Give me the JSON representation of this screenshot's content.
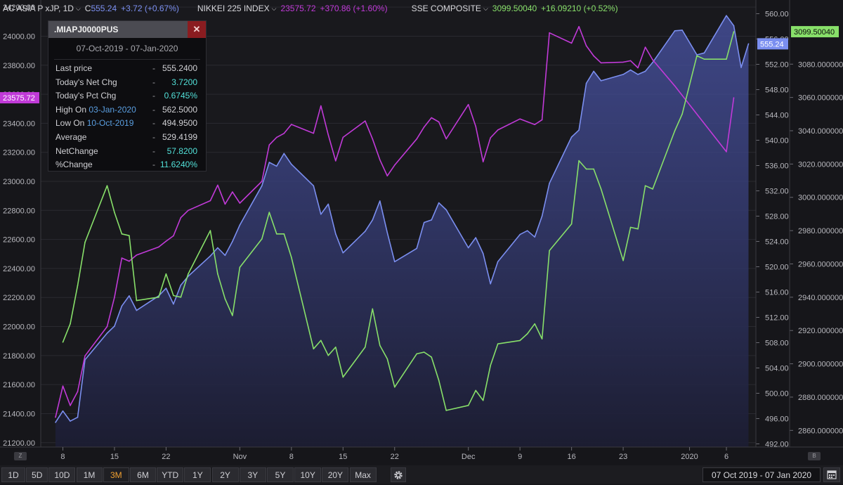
{
  "legend": {
    "s1_name": "AC ASIA P xJP, 1D",
    "s1_prefix": "C",
    "s1_last": "555.24",
    "s1_change": "+3.72 (+0.67%)",
    "s2_name": "NIKKEI 225 INDEX",
    "s2_last": "23575.72",
    "s2_change": "+370.86 (+1.60%)",
    "s3_name": "SSE COMPOSITE",
    "s3_last": "3099.50040",
    "s3_change": "+16.09210 (+0.52%)",
    "chevron": "chevron-down-icon"
  },
  "infobox": {
    "title": ".MIAPJ0000PUS",
    "close": "✕",
    "dates": "07-Oct-2019 - 07-Jan-2020",
    "rows": [
      {
        "label": "Last price",
        "dash": "-",
        "value": "555.2400"
      },
      {
        "label": "Today's Net Chg",
        "dash": "-",
        "value": "3.7200"
      },
      {
        "label": "Today's Pct Chg",
        "dash": "-",
        "value": "0.6745%"
      },
      {
        "label": "High On ",
        "date": "03-Jan-2020",
        "dash": "-",
        "value": "562.5000"
      },
      {
        "label": "Low On ",
        "date": "10-Oct-2019",
        "dash": "-",
        "value": "494.9500"
      },
      {
        "label": "Average",
        "dash": "-",
        "value": "529.4199"
      },
      {
        "label": "NetChange",
        "dash": "-",
        "value": "57.8200"
      },
      {
        "label": "%Change",
        "dash": "-",
        "value": "11.6240%"
      }
    ]
  },
  "toolbar": {
    "ranges": [
      "1D",
      "5D",
      "10D",
      "1M",
      "3M",
      "6M",
      "YTD",
      "1Y",
      "2Y",
      "3Y",
      "5Y",
      "10Y",
      "20Y",
      "Max"
    ],
    "active": "3M",
    "date_range": "07 Oct 2019  -  07 Jan 2020",
    "settings_icon": "gear-icon",
    "calendar_icon": "calendar-icon",
    "zoom_left": "Z",
    "zoom_right": "B"
  },
  "colors": {
    "s1": "#7b8ff0",
    "s2": "#c13ad8",
    "s3": "#88e06a",
    "background": "#16161a"
  },
  "chart_data": {
    "type": "line",
    "x_ticks": [
      "8",
      "15",
      "22",
      "Nov",
      "8",
      "15",
      "22",
      "Dec",
      "9",
      "16",
      "23",
      "2020",
      "6"
    ],
    "x_tick_dates": [
      "2019-10-08",
      "2019-10-15",
      "2019-10-22",
      "2019-11-01",
      "2019-11-08",
      "2019-11-15",
      "2019-11-22",
      "2019-12-02",
      "2019-12-09",
      "2019-12-16",
      "2019-12-23",
      "2020-01-01",
      "2020-01-06"
    ],
    "y_left": {
      "label": "NIKKEI 225 INDEX",
      "ticks": [
        "24200.00",
        "24000.00",
        "23800.00",
        "23600.00",
        "23400.00",
        "23200.00",
        "23000.00",
        "22800.00",
        "22600.00",
        "22400.00",
        "22200.00",
        "22000.00",
        "21800.00",
        "21600.00",
        "21400.00",
        "21200.00"
      ],
      "range": [
        21170,
        24220
      ]
    },
    "y_right1": {
      "label": "AC ASIA P xJP",
      "ticks": [
        "560.00",
        "556.00",
        "552.00",
        "548.00",
        "544.00",
        "540.00",
        "536.00",
        "532.00",
        "528.00",
        "524.00",
        "520.00",
        "516.00",
        "512.00",
        "508.00",
        "504.00",
        "500.00",
        "496.00",
        "492.00"
      ],
      "range": [
        491.5,
        561.5
      ]
    },
    "y_right2": {
      "label": "SSE COMPOSITE",
      "ticks": [
        "3080.000000",
        "3060.000000",
        "3040.000000",
        "3020.000000",
        "3000.000000",
        "2980.000000",
        "2960.000000",
        "2940.000000",
        "2920.000000",
        "2900.000000",
        "2880.000000",
        "2860.000000"
      ],
      "range": [
        2850,
        3116
      ]
    },
    "last_labels": {
      "s1": "555.24",
      "s2": "23575.72",
      "s3": "3099.50040"
    },
    "series": [
      {
        "name": "AC ASIA P xJP",
        "color": "#7b8ff0",
        "area": true,
        "points": [
          [
            "2019-10-07",
            495.4
          ],
          [
            "2019-10-08",
            497.2
          ],
          [
            "2019-10-09",
            495.6
          ],
          [
            "2019-10-10",
            496.2
          ],
          [
            "2019-10-11",
            505.3
          ],
          [
            "2019-10-14",
            509.5
          ],
          [
            "2019-10-15",
            510.6
          ],
          [
            "2019-10-16",
            513.8
          ],
          [
            "2019-10-17",
            515.4
          ],
          [
            "2019-10-18",
            513.1
          ],
          [
            "2019-10-21",
            515.4
          ],
          [
            "2019-10-22",
            516.6
          ],
          [
            "2019-10-23",
            514.1
          ],
          [
            "2019-10-24",
            517.1
          ],
          [
            "2019-10-25",
            518.5
          ],
          [
            "2019-10-28",
            521.7
          ],
          [
            "2019-10-29",
            523.0
          ],
          [
            "2019-10-30",
            521.8
          ],
          [
            "2019-10-31",
            524.0
          ],
          [
            "2019-11-01",
            526.6
          ],
          [
            "2019-11-04",
            532.8
          ],
          [
            "2019-11-05",
            536.5
          ],
          [
            "2019-11-06",
            535.9
          ],
          [
            "2019-11-07",
            537.9
          ],
          [
            "2019-11-08",
            536.2
          ],
          [
            "2019-11-11",
            532.8
          ],
          [
            "2019-11-12",
            528.3
          ],
          [
            "2019-11-13",
            529.9
          ],
          [
            "2019-11-14",
            525.2
          ],
          [
            "2019-11-15",
            522.2
          ],
          [
            "2019-11-18",
            525.6
          ],
          [
            "2019-11-19",
            527.4
          ],
          [
            "2019-11-20",
            530.4
          ],
          [
            "2019-11-21",
            525.4
          ],
          [
            "2019-11-22",
            520.8
          ],
          [
            "2019-11-25",
            522.9
          ],
          [
            "2019-11-26",
            527.0
          ],
          [
            "2019-11-27",
            527.4
          ],
          [
            "2019-11-28",
            530.1
          ],
          [
            "2019-11-29",
            529.0
          ],
          [
            "2019-12-02",
            523.0
          ],
          [
            "2019-12-03",
            524.6
          ],
          [
            "2019-12-04",
            522.1
          ],
          [
            "2019-12-05",
            517.3
          ],
          [
            "2019-12-06",
            520.8
          ],
          [
            "2019-12-09",
            525.1
          ],
          [
            "2019-12-10",
            525.7
          ],
          [
            "2019-12-11",
            524.7
          ],
          [
            "2019-12-12",
            528.0
          ],
          [
            "2019-12-13",
            533.2
          ],
          [
            "2019-12-16",
            540.5
          ],
          [
            "2019-12-17",
            541.6
          ],
          [
            "2019-12-18",
            549.0
          ],
          [
            "2019-12-19",
            550.9
          ],
          [
            "2019-12-20",
            549.4
          ],
          [
            "2019-12-23",
            550.4
          ],
          [
            "2019-12-24",
            551.1
          ],
          [
            "2019-12-25",
            550.4
          ],
          [
            "2019-12-26",
            550.9
          ],
          [
            "2019-12-27",
            552.3
          ],
          [
            "2019-12-30",
            557.3
          ],
          [
            "2019-12-31",
            557.4
          ],
          [
            "2020-01-02",
            553.5
          ],
          [
            "2020-01-03",
            553.8
          ],
          [
            "2020-01-06",
            559.7
          ],
          [
            "2020-01-07",
            558.1
          ],
          [
            "2020-01-08",
            551.5
          ],
          [
            "2020-01-09",
            555.24
          ]
        ]
      },
      {
        "name": "NIKKEI 225 INDEX",
        "color": "#c13ad8",
        "area": false,
        "points": [
          [
            "2019-10-07",
            21375
          ],
          [
            "2019-10-08",
            21590
          ],
          [
            "2019-10-09",
            21456
          ],
          [
            "2019-10-10",
            21552
          ],
          [
            "2019-10-11",
            21798
          ],
          [
            "2019-10-14",
            22000
          ],
          [
            "2019-10-15",
            22200
          ],
          [
            "2019-10-16",
            22472
          ],
          [
            "2019-10-17",
            22450
          ],
          [
            "2019-10-18",
            22492
          ],
          [
            "2019-10-21",
            22548
          ],
          [
            "2019-10-22",
            22588
          ],
          [
            "2019-10-23",
            22625
          ],
          [
            "2019-10-24",
            22750
          ],
          [
            "2019-10-25",
            22800
          ],
          [
            "2019-10-28",
            22867
          ],
          [
            "2019-10-29",
            22974
          ],
          [
            "2019-10-30",
            22843
          ],
          [
            "2019-10-31",
            22927
          ],
          [
            "2019-11-01",
            22850
          ],
          [
            "2019-11-04",
            23000
          ],
          [
            "2019-11-05",
            23251
          ],
          [
            "2019-11-06",
            23303
          ],
          [
            "2019-11-07",
            23330
          ],
          [
            "2019-11-08",
            23392
          ],
          [
            "2019-11-11",
            23331
          ],
          [
            "2019-11-12",
            23520
          ],
          [
            "2019-11-13",
            23320
          ],
          [
            "2019-11-14",
            23141
          ],
          [
            "2019-11-15",
            23303
          ],
          [
            "2019-11-18",
            23416
          ],
          [
            "2019-11-19",
            23292
          ],
          [
            "2019-11-20",
            23148
          ],
          [
            "2019-11-21",
            23038
          ],
          [
            "2019-11-22",
            23112
          ],
          [
            "2019-11-25",
            23292
          ],
          [
            "2019-11-26",
            23374
          ],
          [
            "2019-11-27",
            23438
          ],
          [
            "2019-11-28",
            23409
          ],
          [
            "2019-11-29",
            23293
          ],
          [
            "2019-12-02",
            23529
          ],
          [
            "2019-12-03",
            23379
          ],
          [
            "2019-12-04",
            23135
          ],
          [
            "2019-12-05",
            23300
          ],
          [
            "2019-12-06",
            23354
          ],
          [
            "2019-12-09",
            23430
          ],
          [
            "2019-12-10",
            23410
          ],
          [
            "2019-12-11",
            23391
          ],
          [
            "2019-12-12",
            23424
          ],
          [
            "2019-12-13",
            24023
          ],
          [
            "2019-12-16",
            23952
          ],
          [
            "2019-12-17",
            24066
          ],
          [
            "2019-12-18",
            23934
          ],
          [
            "2019-12-19",
            23864
          ],
          [
            "2019-12-20",
            23816
          ],
          [
            "2019-12-23",
            23821
          ],
          [
            "2019-12-24",
            23831
          ],
          [
            "2019-12-25",
            23782
          ],
          [
            "2019-12-26",
            23924
          ],
          [
            "2019-12-27",
            23837
          ],
          [
            "2019-12-30",
            23657
          ],
          [
            "2020-01-06",
            23204
          ],
          [
            "2020-01-07",
            23575.72
          ]
        ]
      },
      {
        "name": "SSE COMPOSITE",
        "color": "#88e06a",
        "area": false,
        "points": [
          [
            "2019-10-08",
            2913
          ],
          [
            "2019-10-09",
            2924
          ],
          [
            "2019-10-10",
            2947
          ],
          [
            "2019-10-11",
            2973
          ],
          [
            "2019-10-14",
            3007
          ],
          [
            "2019-10-15",
            2991
          ],
          [
            "2019-10-16",
            2978
          ],
          [
            "2019-10-17",
            2977
          ],
          [
            "2019-10-18",
            2938
          ],
          [
            "2019-10-21",
            2940
          ],
          [
            "2019-10-22",
            2954
          ],
          [
            "2019-10-23",
            2941
          ],
          [
            "2019-10-24",
            2940
          ],
          [
            "2019-10-25",
            2954
          ],
          [
            "2019-10-28",
            2980
          ],
          [
            "2019-10-29",
            2954
          ],
          [
            "2019-10-30",
            2939
          ],
          [
            "2019-10-31",
            2929
          ],
          [
            "2019-11-01",
            2958
          ],
          [
            "2019-11-04",
            2975
          ],
          [
            "2019-11-05",
            2991
          ],
          [
            "2019-11-06",
            2978
          ],
          [
            "2019-11-07",
            2978
          ],
          [
            "2019-11-08",
            2964
          ],
          [
            "2019-11-11",
            2909
          ],
          [
            "2019-11-12",
            2914
          ],
          [
            "2019-11-13",
            2905
          ],
          [
            "2019-11-14",
            2910
          ],
          [
            "2019-11-15",
            2892
          ],
          [
            "2019-11-18",
            2910
          ],
          [
            "2019-11-19",
            2933
          ],
          [
            "2019-11-20",
            2911
          ],
          [
            "2019-11-21",
            2903
          ],
          [
            "2019-11-22",
            2886
          ],
          [
            "2019-11-25",
            2906
          ],
          [
            "2019-11-26",
            2907
          ],
          [
            "2019-11-27",
            2904
          ],
          [
            "2019-11-28",
            2890
          ],
          [
            "2019-11-29",
            2872
          ],
          [
            "2019-12-02",
            2875
          ],
          [
            "2019-12-03",
            2884
          ],
          [
            "2019-12-04",
            2878
          ],
          [
            "2019-12-05",
            2899
          ],
          [
            "2019-12-06",
            2912
          ],
          [
            "2019-12-09",
            2914
          ],
          [
            "2019-12-10",
            2918
          ],
          [
            "2019-12-11",
            2924
          ],
          [
            "2019-12-12",
            2915
          ],
          [
            "2019-12-13",
            2968
          ],
          [
            "2019-12-16",
            2984
          ],
          [
            "2019-12-17",
            3022
          ],
          [
            "2019-12-18",
            3017
          ],
          [
            "2019-12-19",
            3017
          ],
          [
            "2019-12-20",
            3005
          ],
          [
            "2019-12-23",
            2962
          ],
          [
            "2019-12-24",
            2982
          ],
          [
            "2019-12-25",
            2981
          ],
          [
            "2019-12-26",
            3007
          ],
          [
            "2019-12-27",
            3005
          ],
          [
            "2019-12-30",
            3040
          ],
          [
            "2019-12-31",
            3050
          ],
          [
            "2020-01-02",
            3085
          ],
          [
            "2020-01-03",
            3083
          ],
          [
            "2020-01-06",
            3083
          ],
          [
            "2020-01-07",
            3099.5
          ]
        ]
      }
    ]
  }
}
